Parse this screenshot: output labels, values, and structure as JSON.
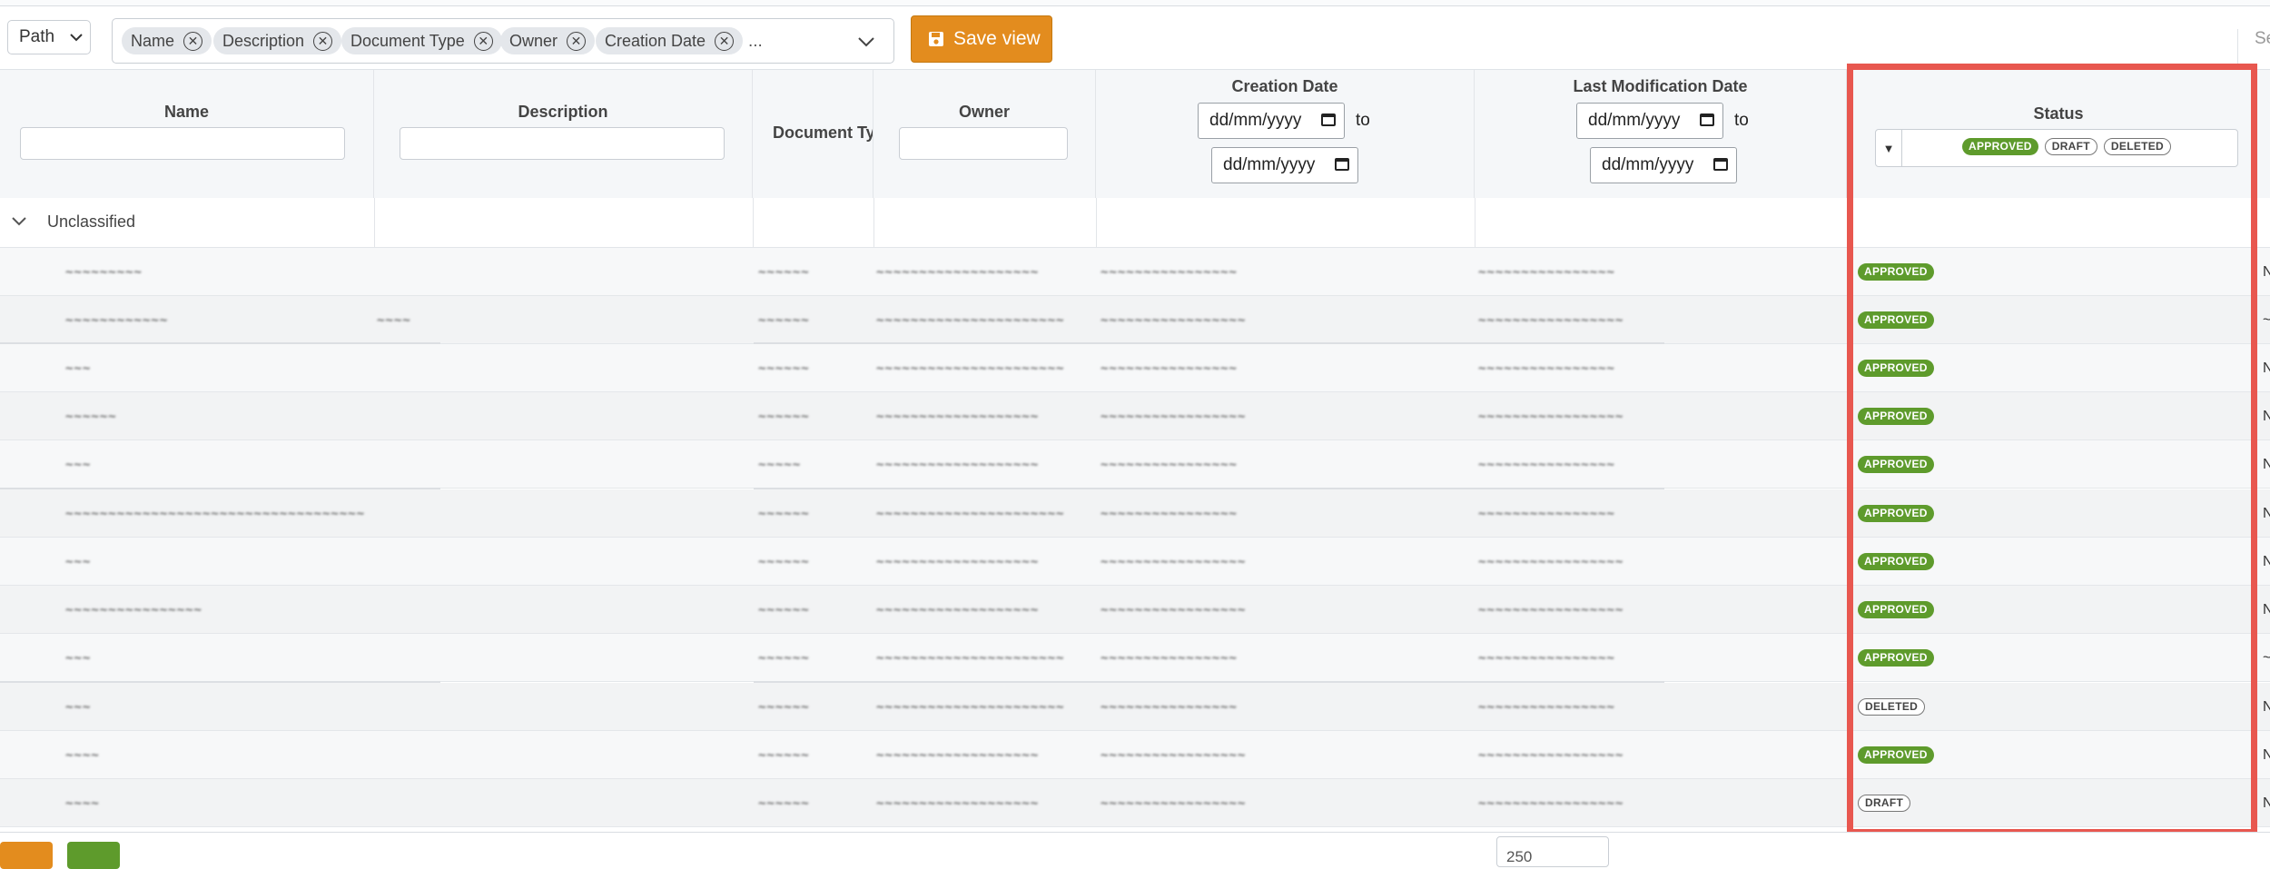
{
  "toolbar": {
    "path_label": "Path",
    "chips": [
      "Name",
      "Description",
      "Document Type",
      "Owner",
      "Creation Date"
    ],
    "more": "...",
    "save_label": "Save view",
    "select_text": "Sel"
  },
  "columns": {
    "name": "Name",
    "description": "Description",
    "document_type": "Document Ty",
    "owner": "Owner",
    "creation_date": "Creation Date",
    "last_modification_date": "Last Modification Date",
    "status": "Status"
  },
  "date_filter": {
    "placeholder": "dd/mm/yyyy",
    "to": "to"
  },
  "status_filter": {
    "selected": [
      "APPROVED",
      "DRAFT",
      "DELETED"
    ]
  },
  "group": {
    "label": "Unclassified"
  },
  "rows": [
    {
      "name": "~~~~~~~~~",
      "description": "",
      "type": "~~~~~~",
      "owner": "~~~~~~~~~~~~~~~~~~~",
      "created": "~~~~~~~~~~~~~~~~",
      "modified": "~~~~~~~~~~~~~~~~",
      "status": "APPROVED",
      "trail": "N"
    },
    {
      "name": "~~~~~~~~~~~~",
      "description": "~~~~",
      "type": "~~~~~~",
      "owner": "~~~~~~~~~~~~~~~~~~~~~~",
      "created": "~~~~~~~~~~~~~~~~~",
      "modified": "~~~~~~~~~~~~~~~~~",
      "status": "APPROVED",
      "trail": "~"
    },
    {
      "name": "~~~",
      "description": "",
      "type": "~~~~~~",
      "owner": "~~~~~~~~~~~~~~~~~~~~~~",
      "created": "~~~~~~~~~~~~~~~~",
      "modified": "~~~~~~~~~~~~~~~~",
      "status": "APPROVED",
      "trail": "N"
    },
    {
      "name": "~~~~~~",
      "description": "",
      "type": "~~~~~~",
      "owner": "~~~~~~~~~~~~~~~~~~~",
      "created": "~~~~~~~~~~~~~~~~~",
      "modified": "~~~~~~~~~~~~~~~~~",
      "status": "APPROVED",
      "trail": "N"
    },
    {
      "name": "~~~",
      "description": "",
      "type": "~~~~~",
      "owner": "~~~~~~~~~~~~~~~~~~~",
      "created": "~~~~~~~~~~~~~~~~",
      "modified": "~~~~~~~~~~~~~~~~",
      "status": "APPROVED",
      "trail": "N"
    },
    {
      "name": "~~~~~~~~~~~~~~~~~~~~~~~~~~~~~~~~~~~",
      "description": "",
      "type": "~~~~~~",
      "owner": "~~~~~~~~~~~~~~~~~~~~~~",
      "created": "~~~~~~~~~~~~~~~~",
      "modified": "~~~~~~~~~~~~~~~~",
      "status": "APPROVED",
      "trail": "N"
    },
    {
      "name": "~~~",
      "description": "",
      "type": "~~~~~~",
      "owner": "~~~~~~~~~~~~~~~~~~~",
      "created": "~~~~~~~~~~~~~~~~~",
      "modified": "~~~~~~~~~~~~~~~~~",
      "status": "APPROVED",
      "trail": "N"
    },
    {
      "name": "~~~~~~~~~~~~~~~~",
      "description": "",
      "type": "~~~~~~",
      "owner": "~~~~~~~~~~~~~~~~~~~",
      "created": "~~~~~~~~~~~~~~~~~",
      "modified": "~~~~~~~~~~~~~~~~~",
      "status": "APPROVED",
      "trail": "N"
    },
    {
      "name": "~~~",
      "description": "",
      "type": "~~~~~~",
      "owner": "~~~~~~~~~~~~~~~~~~~~~~",
      "created": "~~~~~~~~~~~~~~~~",
      "modified": "~~~~~~~~~~~~~~~~",
      "status": "APPROVED",
      "trail": "~"
    },
    {
      "name": "~~~",
      "description": "",
      "type": "~~~~~~",
      "owner": "~~~~~~~~~~~~~~~~~~~~~~",
      "created": "~~~~~~~~~~~~~~~~",
      "modified": "~~~~~~~~~~~~~~~~",
      "status": "DELETED",
      "trail": "N"
    },
    {
      "name": "~~~~",
      "description": "",
      "type": "~~~~~~",
      "owner": "~~~~~~~~~~~~~~~~~~~",
      "created": "~~~~~~~~~~~~~~~~~",
      "modified": "~~~~~~~~~~~~~~~~~",
      "status": "APPROVED",
      "trail": "N"
    },
    {
      "name": "~~~~",
      "description": "",
      "type": "~~~~~~",
      "owner": "~~~~~~~~~~~~~~~~~~~",
      "created": "~~~~~~~~~~~~~~~~~",
      "modified": "~~~~~~~~~~~~~~~~~",
      "status": "DRAFT",
      "trail": "N"
    }
  ],
  "footer": {
    "page_size": "250"
  },
  "colors": {
    "accent_orange": "#e38c1e",
    "approved_green": "#5e9b2c",
    "highlight_red": "#e8574f"
  }
}
